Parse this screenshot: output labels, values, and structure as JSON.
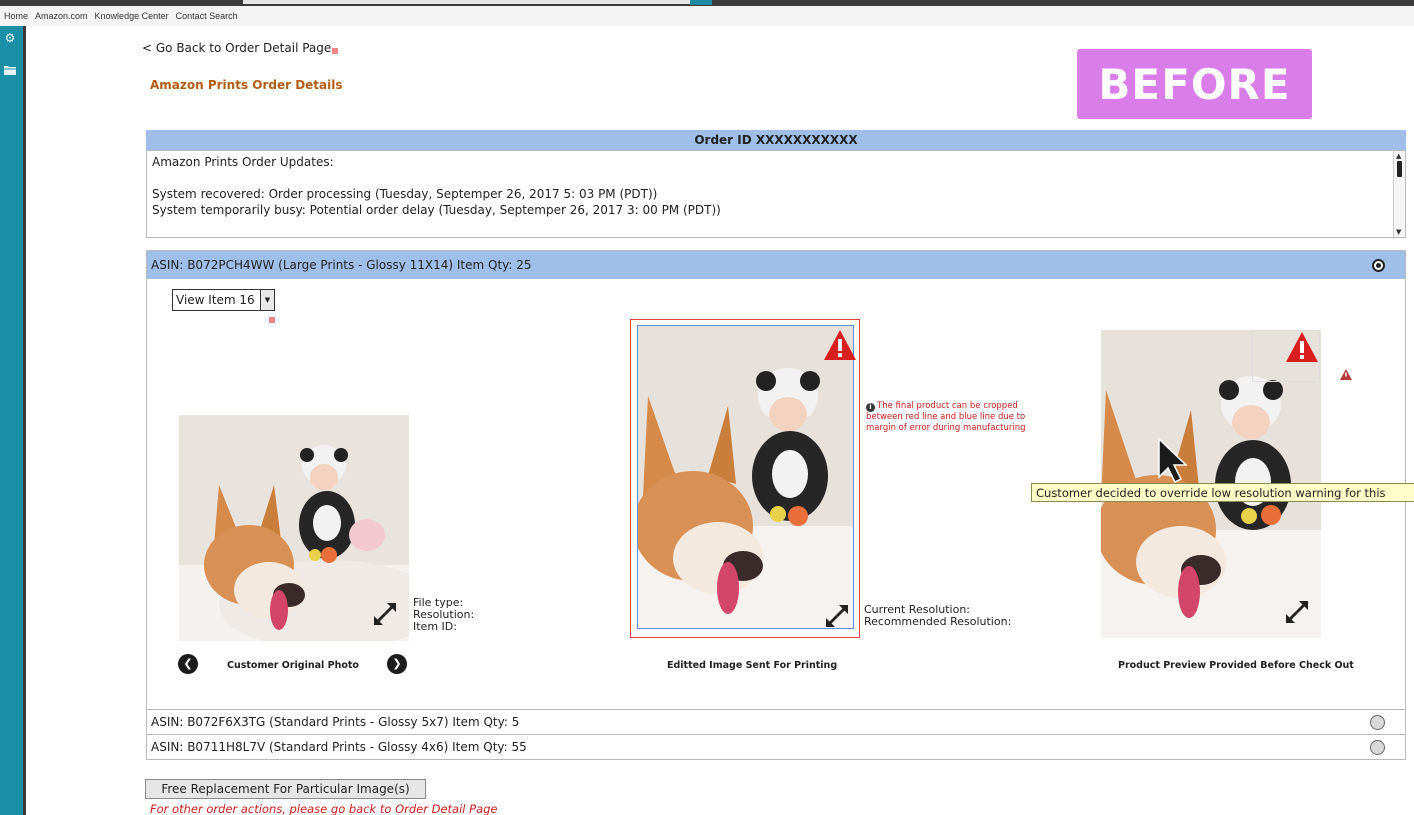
{
  "nav": {
    "items": [
      "Home",
      "Amazon.com",
      "Knowledge Center",
      "Contact Search"
    ]
  },
  "icons": {
    "rail": [
      "gear-icon",
      "folder-icon"
    ]
  },
  "back_link": "< Go Back to Order Detail Page",
  "page_title": "Amazon Prints Order Details",
  "badge": "BEFORE",
  "order": {
    "header": "Order ID XXXXXXXXXXX",
    "updates_title": "Amazon Prints Order Updates:",
    "updates": [
      "System recovered: Order processing (Tuesday, Septemper 26, 2017 5: 03 PM (PDT))",
      "System temporarily busy: Potential order delay (Tuesday, Septemper 26, 2017 3: 00 PM (PDT))"
    ]
  },
  "asin_active": {
    "label": "ASIN: B072PCH4WW (Large Prints - Glossy 11X14)  Item Qty: 25",
    "view_item": "View Item 16",
    "original": {
      "caption": "Customer Original Photo",
      "meta": [
        "File type:",
        "Resolution:",
        "Item ID:"
      ]
    },
    "edited": {
      "caption": "Editted Image Sent For Printing",
      "meta": [
        "Current Resolution:",
        "Recommended Resolution:"
      ],
      "crop_note": "The final product can be cropped between red line and blue line due to margin of error during manufacturing"
    },
    "preview": {
      "caption": "Product Preview Provided Before Check Out",
      "tooltip": "Customer decided to override low resolution warning for this"
    }
  },
  "asin_rows": [
    {
      "label": "ASIN: B072F6X3TG (Standard Prints - Glossy 5x7)  Item Qty: 5"
    },
    {
      "label": "ASIN: B0711H8L7V (Standard Prints - Glossy 4x6)  Item Qty: 55"
    }
  ],
  "replace_button": "Free Replacement For Particular Image(s)",
  "other_actions_note": "For other order actions, please go back to Order Detail Page",
  "colors": {
    "accent_rail": "#1b8fa5",
    "header_blue": "#9fbfe9",
    "title_orange": "#b25d12",
    "badge_purple": "#d97de8",
    "warning_red": "#c62020"
  }
}
